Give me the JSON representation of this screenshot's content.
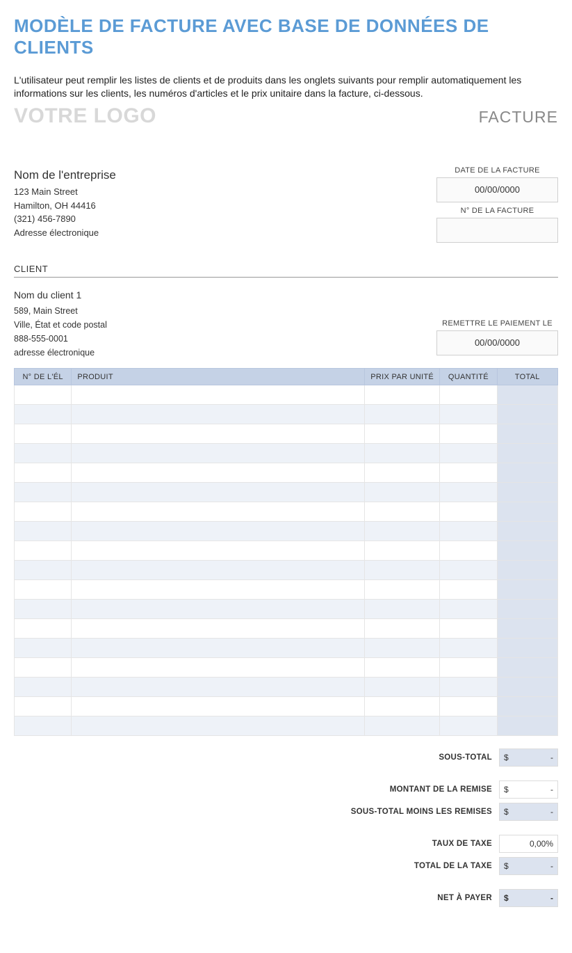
{
  "title": "MODÈLE DE FACTURE AVEC BASE DE DONNÉES DE CLIENTS",
  "description": "L'utilisateur peut remplir les listes de clients et de produits dans les onglets suivants pour remplir automatiquement les informations sur les clients, les numéros d'articles et le prix unitaire dans la facture, ci-dessous.",
  "logo_text": "VOTRE LOGO",
  "facture_word": "FACTURE",
  "company": {
    "name": "Nom de l'entreprise",
    "street": "123 Main Street",
    "city_line": "Hamilton, OH 44416",
    "phone": "(321) 456-7890",
    "email": "Adresse électronique"
  },
  "invoice_meta": {
    "date_label": "DATE DE LA FACTURE",
    "date_value": "00/00/0000",
    "number_label": "N° DE LA FACTURE",
    "number_value": ""
  },
  "client_heading": "CLIENT",
  "client": {
    "name": "Nom du client 1",
    "street": "589, Main Street",
    "city_line": "Ville, État et code postal",
    "phone": "888-555-0001",
    "email": "adresse électronique"
  },
  "payment": {
    "label": "REMETTRE LE PAIEMENT LE",
    "value": "00/00/0000"
  },
  "table": {
    "headers": {
      "num": "N° DE L'ÉL",
      "product": "PRODUIT",
      "price": "PRIX PAR UNITÉ",
      "qty": "QUANTITÉ",
      "total": "TOTAL"
    },
    "row_count": 18
  },
  "totals": {
    "subtotal_label": "SOUS-TOTAL",
    "discount_label": "MONTANT DE LA REMISE",
    "sub_less_discount_label": "SOUS-TOTAL MOINS LES REMISES",
    "tax_rate_label": "TAUX DE TAXE",
    "tax_rate_value": "0,00%",
    "tax_total_label": "TOTAL DE LA TAXE",
    "net_label": "NET À PAYER",
    "currency": "$",
    "dash": "-"
  }
}
